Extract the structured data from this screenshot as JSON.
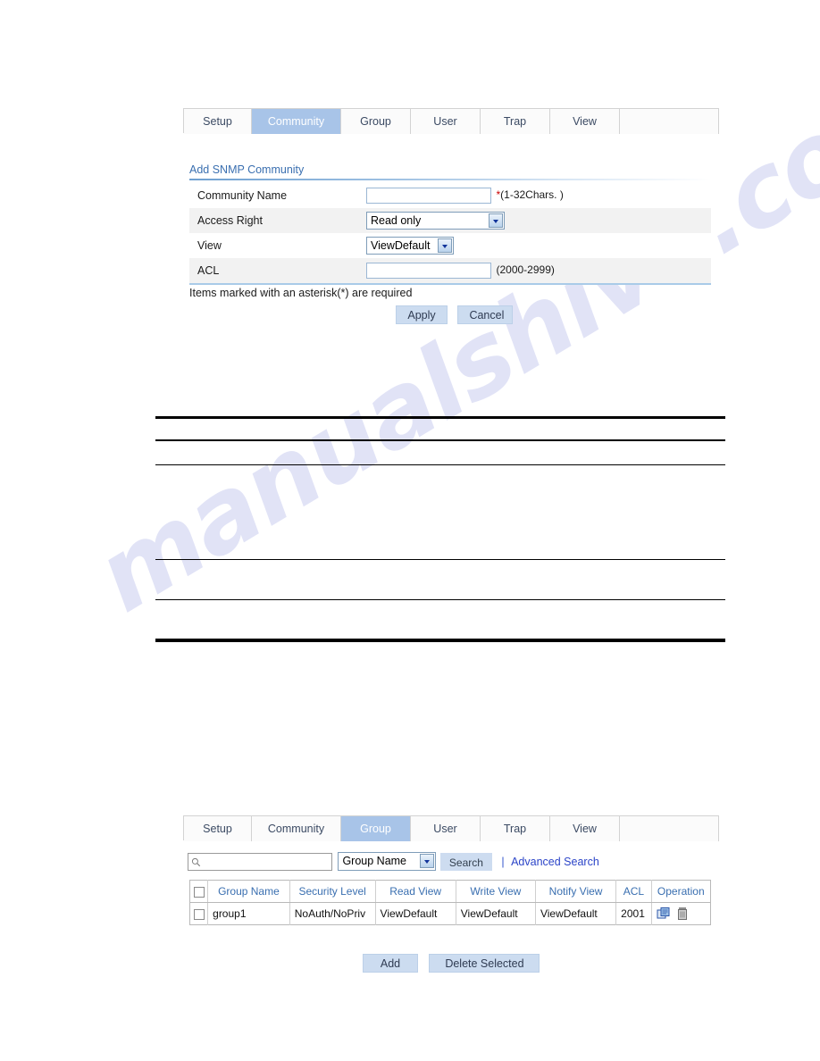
{
  "watermark": {
    "text": "manualshive.com"
  },
  "top_panel": {
    "tabs": [
      {
        "label": "Setup",
        "active": false
      },
      {
        "label": "Community",
        "active": true
      },
      {
        "label": "Group",
        "active": false
      },
      {
        "label": "User",
        "active": false
      },
      {
        "label": "Trap",
        "active": false
      },
      {
        "label": "View",
        "active": false
      }
    ],
    "section_title": "Add SNMP Community",
    "form_rows": [
      {
        "label": "Community Name",
        "control": "text",
        "value": "",
        "hint": "*(1-32Chars. )",
        "required": true
      },
      {
        "label": "Access Right",
        "control": "select",
        "value": "Read only",
        "hint": ""
      },
      {
        "label": "View",
        "control": "select",
        "value": "ViewDefault",
        "hint": ""
      },
      {
        "label": "ACL",
        "control": "text",
        "value": "",
        "hint": "(2000-2999)",
        "required": false
      }
    ],
    "note": "Items marked with an asterisk(*) are required",
    "apply_label": "Apply",
    "cancel_label": "Cancel"
  },
  "bottom_panel": {
    "tabs": [
      {
        "label": "Setup",
        "active": false
      },
      {
        "label": "Community",
        "active": false
      },
      {
        "label": "Group",
        "active": true
      },
      {
        "label": "User",
        "active": false
      },
      {
        "label": "Trap",
        "active": false
      },
      {
        "label": "View",
        "active": false
      }
    ],
    "search": {
      "value": "",
      "icon": "search-icon",
      "field_selector": "Group Name",
      "button_label": "Search",
      "separator": "|",
      "advanced_label": "Advanced Search"
    },
    "table": {
      "columns": [
        "",
        "Group Name",
        "Security Level",
        "Read View",
        "Write View",
        "Notify View",
        "ACL",
        "Operation"
      ],
      "rows": [
        {
          "group_name": "group1",
          "security_level": "NoAuth/NoPriv",
          "read_view": "ViewDefault",
          "write_view": "ViewDefault",
          "notify_view": "ViewDefault",
          "acl": "2001",
          "operations": [
            "edit-icon",
            "delete-icon"
          ]
        }
      ]
    },
    "add_label": "Add",
    "delete_selected_label": "Delete Selected"
  },
  "colors": {
    "active_tab_bg": "#a8c4e8",
    "link_blue": "#2b44c8",
    "header_blue": "#3a6fb0",
    "button_bg": "#ccdcf0",
    "required_red": "#cc0000"
  }
}
